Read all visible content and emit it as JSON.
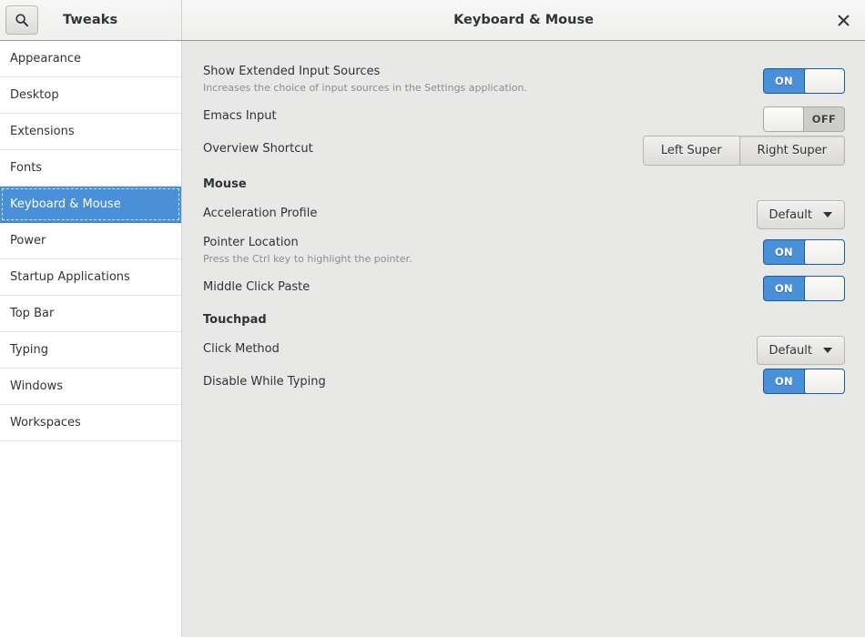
{
  "header": {
    "app_title": "Tweaks",
    "page_title": "Keyboard & Mouse",
    "search_icon": "search-icon",
    "close_icon": "close-icon",
    "close_glyph": "✕"
  },
  "sidebar": {
    "items": [
      {
        "label": "Appearance",
        "selected": false
      },
      {
        "label": "Desktop",
        "selected": false
      },
      {
        "label": "Extensions",
        "selected": false
      },
      {
        "label": "Fonts",
        "selected": false
      },
      {
        "label": "Keyboard & Mouse",
        "selected": true
      },
      {
        "label": "Power",
        "selected": false
      },
      {
        "label": "Startup Applications",
        "selected": false
      },
      {
        "label": "Top Bar",
        "selected": false
      },
      {
        "label": "Typing",
        "selected": false
      },
      {
        "label": "Windows",
        "selected": false
      },
      {
        "label": "Workspaces",
        "selected": false
      }
    ]
  },
  "content": {
    "rows": [
      {
        "key": "show_extended_input_sources",
        "label": "Show Extended Input Sources",
        "description": "Increases the choice of input sources in the Settings application.",
        "control": "switch",
        "value": "ON"
      },
      {
        "key": "emacs_input",
        "label": "Emacs Input",
        "description": "",
        "control": "switch",
        "value": "OFF"
      },
      {
        "key": "overview_shortcut",
        "label": "Overview Shortcut",
        "description": "",
        "control": "segmented",
        "options": [
          "Left Super",
          "Right Super"
        ],
        "value": "Right Super"
      },
      {
        "key": "mouse_section",
        "label": "Mouse",
        "description": "",
        "control": "none",
        "value": ""
      },
      {
        "key": "acceleration_profile",
        "label": "Acceleration Profile",
        "description": "",
        "control": "combo",
        "value": "Default"
      },
      {
        "key": "pointer_location",
        "label": "Pointer Location",
        "description": "Press the Ctrl key to highlight the pointer.",
        "control": "switch",
        "value": "ON"
      },
      {
        "key": "middle_click_paste",
        "label": "Middle Click Paste",
        "description": "",
        "control": "switch",
        "value": "ON"
      },
      {
        "key": "touchpad_section",
        "label": "Touchpad",
        "description": "",
        "control": "none",
        "value": ""
      },
      {
        "key": "click_method",
        "label": "Click Method",
        "description": "",
        "control": "combo",
        "value": "Default"
      },
      {
        "key": "disable_while_typing",
        "label": "Disable While Typing",
        "description": "",
        "control": "switch",
        "value": "ON"
      }
    ]
  },
  "colors": {
    "accent": "#4a90d9",
    "window_bg": "#e8e8e7",
    "sidebar_bg": "#ffffff",
    "text": "#2e3436",
    "muted_text": "#8b8e8f"
  }
}
